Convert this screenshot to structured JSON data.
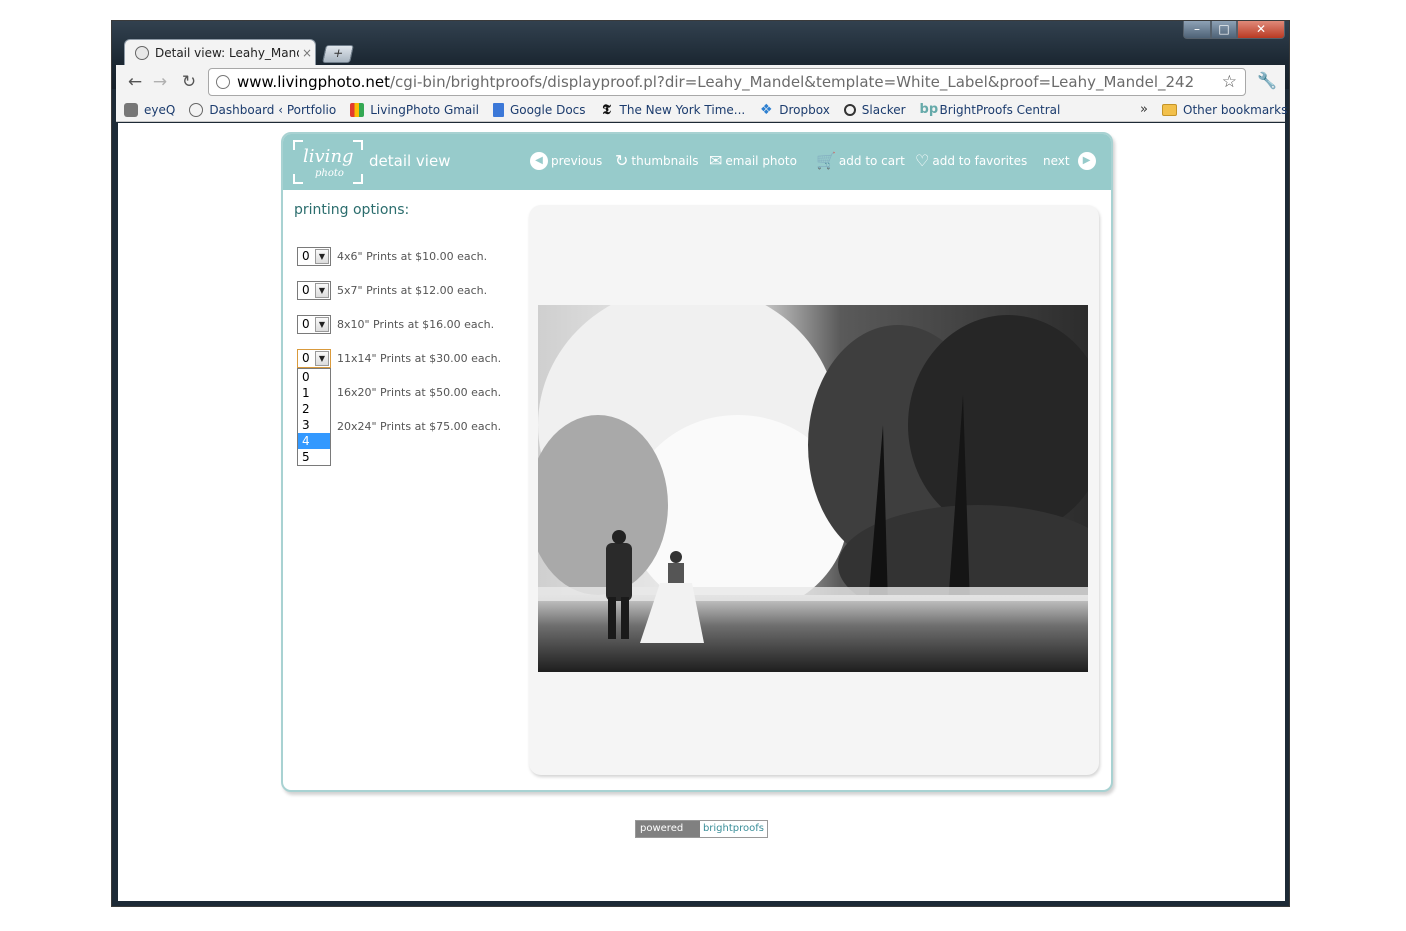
{
  "browser": {
    "tab_title": "Detail view: Leahy_Mandel_",
    "tab_close": "×",
    "new_tab": "+",
    "url_host": "www.livingphoto.net",
    "url_path": "/cgi-bin/brightproofs/displayproof.pl?dir=Leahy_Mandel&template=White_Label&proof=Leahy_Mandel_242",
    "window_controls": {
      "minimize": "–",
      "maximize": "□",
      "close": "✕"
    },
    "bookmarks": [
      {
        "label": "eyeQ",
        "icon": "apple-icon"
      },
      {
        "label": "Dashboard ‹ Portfolio",
        "icon": "globe-icon"
      },
      {
        "label": "LivingPhoto Gmail",
        "icon": "gmail-icon"
      },
      {
        "label": "Google Docs",
        "icon": "docs-icon"
      },
      {
        "label": "The New York Time...",
        "icon": "nyt-icon"
      },
      {
        "label": "Dropbox",
        "icon": "dropbox-icon"
      },
      {
        "label": "Slacker",
        "icon": "slacker-icon"
      },
      {
        "label": "BrightProofs Central",
        "icon": "brightproofs-icon"
      }
    ],
    "overflow_chevron": "»",
    "other_bookmarks": "Other bookmarks"
  },
  "page": {
    "logo_text_1": "living",
    "logo_text_2": "photo",
    "header_title": "detail view",
    "nav": {
      "previous": "previous",
      "thumbnails": "thumbnails",
      "email_photo": "email photo",
      "add_to_cart": "add to cart",
      "add_to_favorites": "add to favorites",
      "next": "next"
    },
    "printing_title": "printing options:",
    "options": [
      {
        "qty": "0",
        "label": "4x6\" Prints at $10.00 each."
      },
      {
        "qty": "0",
        "label": "5x7\" Prints at $12.00 each."
      },
      {
        "qty": "0",
        "label": "8x10\" Prints at $16.00 each."
      },
      {
        "qty": "0",
        "label": "11x14\" Prints at $30.00 each."
      },
      {
        "qty": "0",
        "label": "16x20\" Prints at $50.00 each."
      },
      {
        "qty": "0",
        "label": "20x24\" Prints at $75.00 each."
      }
    ],
    "dropdown_options": [
      "0",
      "1",
      "2",
      "3",
      "4",
      "5"
    ],
    "dropdown_highlighted": "4",
    "powered_by": "powered by",
    "powered_brand": "brightproofs"
  },
  "colors": {
    "accent_teal": "#97cbcb",
    "title_teal": "#2b6d6d",
    "highlight": "#3399ff"
  }
}
